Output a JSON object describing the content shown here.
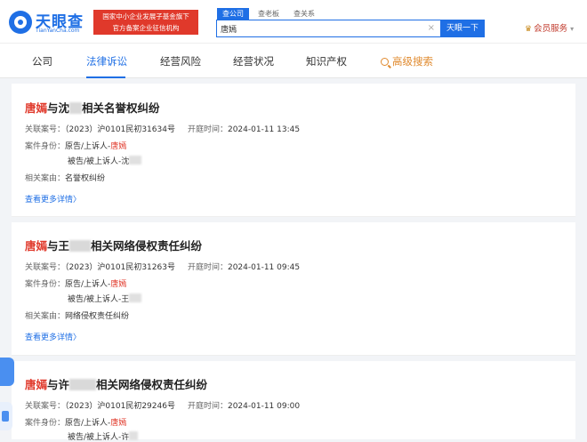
{
  "header": {
    "logo_text": "天眼查",
    "logo_sub": "TianYanCha.com",
    "badge_line1": "国家中小企业发展子基金旗下",
    "badge_line2": "官方备案企业征信机构",
    "search_tabs": [
      "查公司",
      "查老板",
      "查关系"
    ],
    "search_value": "唐嫣",
    "clear_icon": "×",
    "search_button": "天眼一下",
    "vip_icon": "♛",
    "vip_label": "会员服务",
    "vip_arrow": "▾"
  },
  "nav": {
    "items": [
      "公司",
      "法律诉讼",
      "经营风险",
      "经营状况",
      "知识产权",
      "高级搜索"
    ],
    "active_index": 1
  },
  "cases": [
    {
      "title_person": "唐嫣",
      "title_mid": "与沈",
      "title_rest": "相关名誉权纠纷",
      "case_no_label": "关联案号：",
      "case_no": "（2023）沪0101民初31634号",
      "hearing_label": "开庭时间：",
      "hearing_time": "2024-01-11 13:45",
      "role_label": "案件身份：",
      "plaintiff_prefix": "原告/上诉人-",
      "plaintiff_name": "唐嫣",
      "defendant_prefix": "被告/被上诉人-沈",
      "cause_label": "相关案由：",
      "cause": "名誉权纠纷",
      "more": "查看更多详情",
      "more_arrow": "〉"
    },
    {
      "title_person": "唐嫣",
      "title_mid": "与王",
      "title_rest": "相关网络侵权责任纠纷",
      "case_no_label": "关联案号：",
      "case_no": "（2023）沪0101民初31263号",
      "hearing_label": "开庭时间：",
      "hearing_time": "2024-01-11 09:45",
      "role_label": "案件身份：",
      "plaintiff_prefix": "原告/上诉人-",
      "plaintiff_name": "唐嫣",
      "defendant_prefix": "被告/被上诉人-王",
      "cause_label": "相关案由：",
      "cause": "网络侵权责任纠纷",
      "more": "查看更多详情",
      "more_arrow": "〉"
    },
    {
      "title_person": "唐嫣",
      "title_mid": "与许",
      "title_rest": "相关网络侵权责任纠纷",
      "case_no_label": "关联案号：",
      "case_no": "（2023）沪0101民初29246号",
      "hearing_label": "开庭时间：",
      "hearing_time": "2024-01-11 09:00",
      "role_label": "案件身份：",
      "plaintiff_prefix": "原告/上诉人-",
      "plaintiff_name": "唐嫣",
      "defendant_prefix": "被告/被上诉人-许"
    }
  ]
}
